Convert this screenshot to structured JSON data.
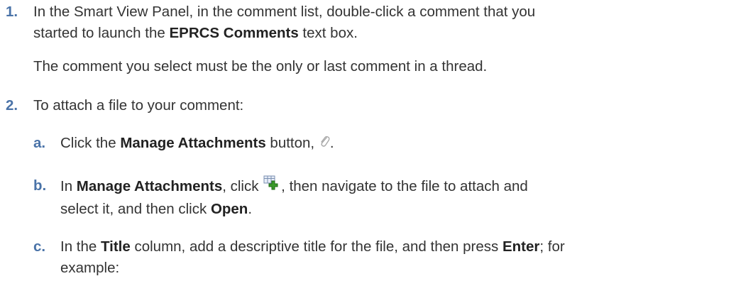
{
  "steps": [
    {
      "number": "1.",
      "line1_pre": "In the Smart View Panel, in the comment list, double-click a comment that you",
      "line2_pre": "started to launch the ",
      "line2_bold": "EPRCS Comments",
      "line2_post": " text box.",
      "note": "The comment you select must be the only or last comment in a thread."
    },
    {
      "number": "2.",
      "text": "To attach a file to your comment:",
      "substeps": [
        {
          "letter": "a.",
          "pre": "Click the ",
          "bold": "Manage Attachments",
          "post": " button, ",
          "end": ".",
          "icon": "paperclip-icon"
        },
        {
          "letter": "b.",
          "pre": "In ",
          "bold1": "Manage Attachments",
          "mid": ", click ",
          "post": ", then navigate to the file to attach and",
          "line2_pre": "select it, and then click ",
          "line2_bold": "Open",
          "line2_post": ".",
          "icon": "add-attachment-icon"
        },
        {
          "letter": "c.",
          "pre": "In the ",
          "bold1": "Title",
          "mid": " column, add a descriptive title for the file, and then press ",
          "bold2": "Enter",
          "post": "; for",
          "line2": "example:"
        }
      ]
    }
  ],
  "colors": {
    "number": "#4a73a8",
    "text": "#333333",
    "icon_green": "#3a9a2a"
  }
}
